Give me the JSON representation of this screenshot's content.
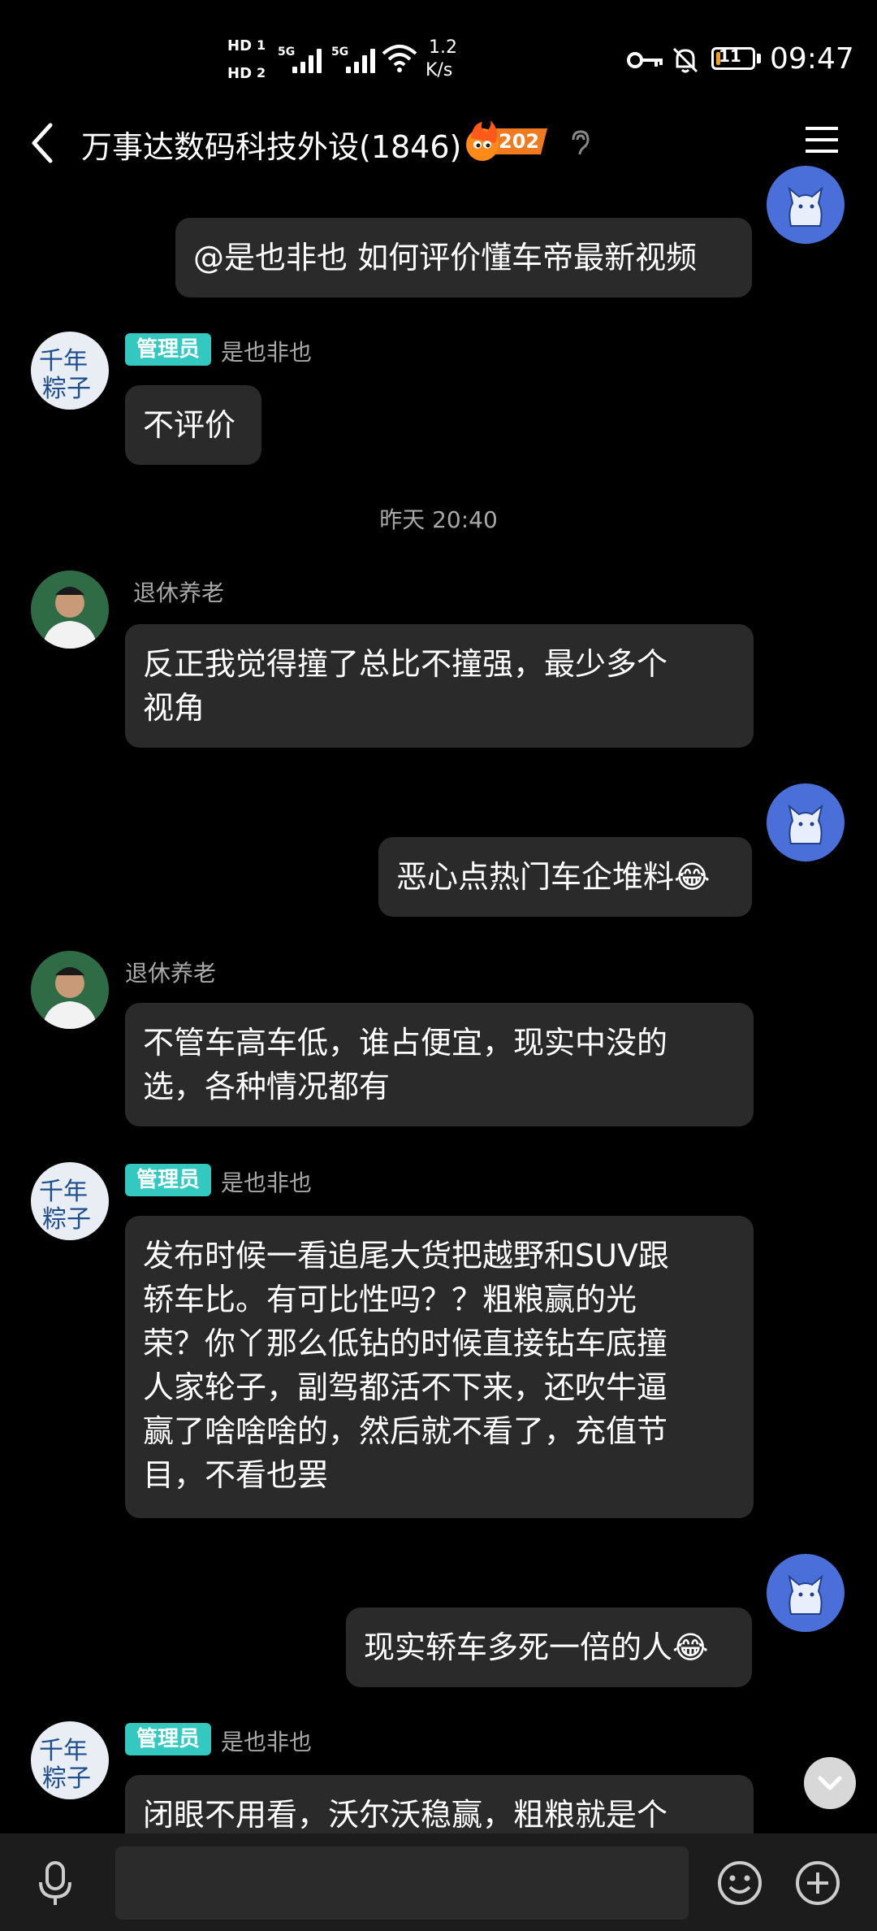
{
  "status_bar": {
    "hd1": "HD",
    "sim1": "1",
    "hd2": "HD",
    "sim2": "2",
    "net1": "5G",
    "net2": "5G",
    "speed_value": "1.2",
    "speed_unit": "K/s",
    "battery": "11",
    "time": "09:47"
  },
  "header": {
    "title": "万事达数码科技外设(1846)",
    "fire_count": "202"
  },
  "messages": [
    {
      "side": "right",
      "lines": [
        "@是也非也 如何评价懂车帝最新视频"
      ]
    },
    {
      "side": "left",
      "admin_badge": "管理员",
      "sender": "是也非也",
      "lines": [
        "不评价"
      ]
    },
    {
      "timestamp": "昨天 20:40"
    },
    {
      "side": "left",
      "sender": "退休养老",
      "lines": [
        "反正我觉得撞了总比不撞强，最少多个",
        "视角"
      ]
    },
    {
      "side": "right",
      "lines": [
        "恶心点热门车企堆料😂"
      ]
    },
    {
      "side": "left",
      "sender": "退休养老",
      "lines": [
        "不管车高车低，谁占便宜，现实中没的",
        "选，各种情况都有"
      ]
    },
    {
      "side": "left",
      "admin_badge": "管理员",
      "sender": "是也非也",
      "lines": [
        "发布时候一看追尾大货把越野和SUV跟",
        "轿车比。有可比性吗？？粗粮赢的光",
        "荣？你丫那么低钻的时候直接钻车底撞",
        "人家轮子，副驾都活不下来，还吹牛逼",
        "赢了啥啥啥的，然后就不看了，充值节",
        "目，不看也罢"
      ]
    },
    {
      "side": "right",
      "lines": [
        "现实轿车多死一倍的人😂"
      ]
    },
    {
      "side": "left",
      "admin_badge": "管理员",
      "sender": "是也非也",
      "lines": [
        "闭眼不用看，沃尔沃稳赢，粗粮就是个"
      ]
    }
  ],
  "icons": {
    "back": "back-arrow-icon",
    "menu": "menu-icon",
    "ear": "ear-icon",
    "mic": "microphone-icon",
    "emoji": "emoji-icon",
    "plus": "plus-icon",
    "scroll_down": "chevron-down-icon"
  },
  "colors": {
    "background": "#000000",
    "bubble": "#2a2a2a",
    "admin_badge": "#33c8c0",
    "secondary_text": "#a8a8a8",
    "my_avatar": "#4a6fd8"
  }
}
